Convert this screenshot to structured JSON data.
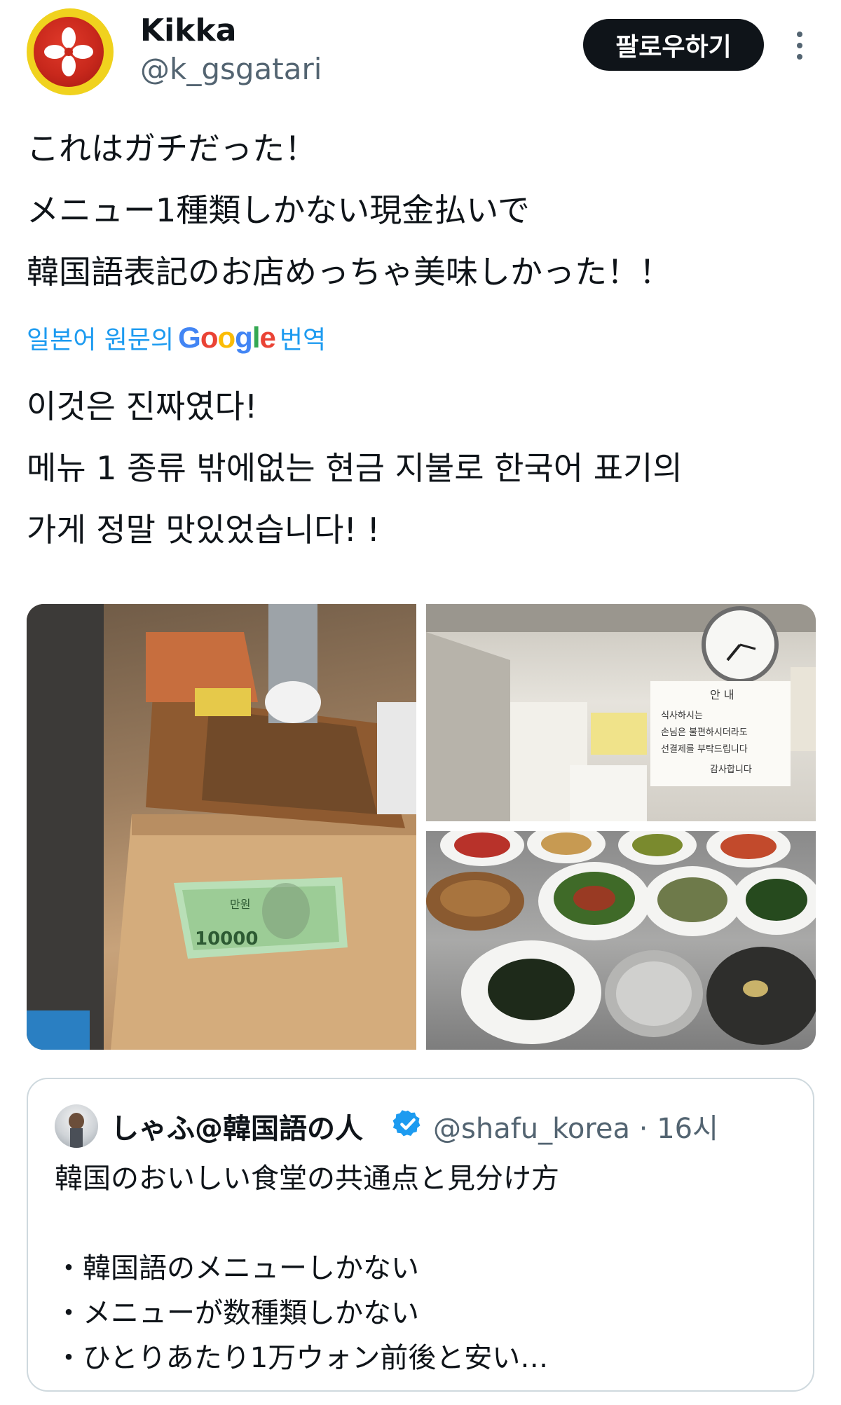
{
  "author": {
    "name": "Kikka",
    "handle": "@k_gsgatari",
    "follow_label": "팔로우하기"
  },
  "tweet": {
    "original_lines": [
      "これはガチだった！",
      "メニュー1種類しかない現金払いで",
      "韓国語表記のお店めっちゃ美味しかった！！"
    ],
    "translate_prefix": "일본어 원문의",
    "translate_brand": "Google",
    "translate_suffix": "번역",
    "translated_lines": [
      "이것은 진짜였다!",
      "메뉴 1 종류 밖에없는 현금 지불로 한국어 표기의",
      "가게 정말 맛있었습니다! !"
    ]
  },
  "photos": {
    "banknote_value": "10000",
    "banknote_word": "만원",
    "notice_title": "안  내",
    "notice_lines": [
      "식사하시는",
      "손님은 불편하시더라도",
      "선결제를 부탁드립니다",
      "감사합니다"
    ]
  },
  "quote": {
    "name": "しゃふ@韓国語の人",
    "handle": "@shafu_korea",
    "separator": "·",
    "time": "16시",
    "lines": [
      "韓国のおいしい食堂の共通点と見分け方",
      "",
      "・韓国語のメニューしかない",
      "・メニューが数種類しかない",
      "・ひとりあたり1万ウォン前後と安い…"
    ]
  },
  "colors": {
    "link": "#1d9bf0",
    "text": "#0f1419",
    "muted": "#536471",
    "button": "#0f1419",
    "verified": "#1d9bf0"
  },
  "icons": [
    "more-vertical-icon",
    "verified-badge-icon"
  ]
}
